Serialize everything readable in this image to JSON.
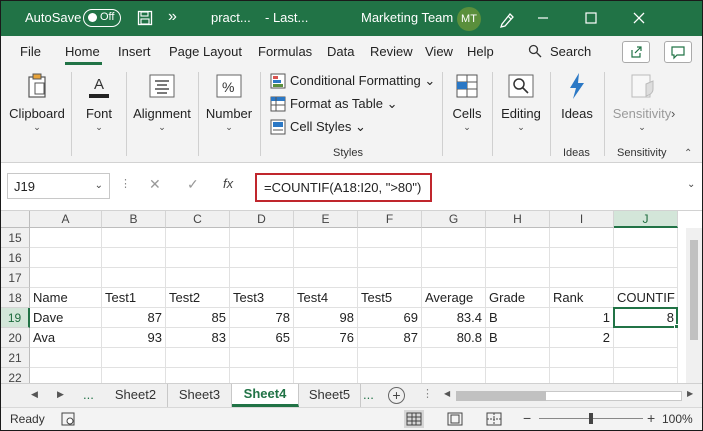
{
  "titlebar": {
    "autosave_label": "AutoSave",
    "autosave_state": "Off",
    "more": "»",
    "doc_name": "pract...",
    "doc_location": "- Last...",
    "team": "Marketing Team",
    "avatar_initials": "MT"
  },
  "tabs": [
    "File",
    "Home",
    "Insert",
    "Page Layout",
    "Formulas",
    "Data",
    "Review",
    "View",
    "Help"
  ],
  "search_label": "Search",
  "ribbon": {
    "clipboard": "Clipboard",
    "font": "Font",
    "alignment": "Alignment",
    "number": "Number",
    "styles": {
      "conditional": "Conditional Formatting",
      "table": "Format as Table",
      "cell_styles": "Cell Styles",
      "caption": "Styles"
    },
    "cells": "Cells",
    "editing": "Editing",
    "ideas": "Ideas",
    "ideas_caption": "Ideas",
    "sensitivity": "Sensitivity",
    "sensitivity_caption": "Sensitivity"
  },
  "formula_bar": {
    "name_box": "J19",
    "fx": "fx",
    "formula": "=COUNTIF(A18:I20, \">80\")"
  },
  "columns": [
    "A",
    "B",
    "C",
    "D",
    "E",
    "F",
    "G",
    "H",
    "I",
    "J"
  ],
  "selected_column": "J",
  "rows": [
    {
      "num": "15",
      "cells": [
        "",
        "",
        "",
        "",
        "",
        "",
        "",
        "",
        "",
        ""
      ]
    },
    {
      "num": "16",
      "cells": [
        "",
        "",
        "",
        "",
        "",
        "",
        "",
        "",
        "",
        ""
      ]
    },
    {
      "num": "17",
      "cells": [
        "",
        "",
        "",
        "",
        "",
        "",
        "",
        "",
        "",
        ""
      ]
    },
    {
      "num": "18",
      "cells": [
        "Name",
        "Test1",
        "Test2",
        "Test3",
        "Test4",
        "Test5",
        "Average",
        "Grade",
        "Rank",
        "COUNTIF"
      ]
    },
    {
      "num": "19",
      "cells": [
        "Dave",
        "87",
        "85",
        "78",
        "98",
        "69",
        "83.4",
        "B",
        "1",
        "8"
      ]
    },
    {
      "num": "20",
      "cells": [
        "Ava",
        "93",
        "83",
        "65",
        "76",
        "87",
        "80.8",
        "B",
        "2",
        ""
      ]
    },
    {
      "num": "21",
      "cells": [
        "",
        "",
        "",
        "",
        "",
        "",
        "",
        "",
        "",
        ""
      ]
    },
    {
      "num": "22",
      "cells": [
        "",
        "",
        "",
        "",
        "",
        "",
        "",
        "",
        "",
        ""
      ]
    }
  ],
  "selected_row": "19",
  "sheets": [
    "Sheet2",
    "Sheet3",
    "Sheet4",
    "Sheet5"
  ],
  "active_sheet": "Sheet4",
  "sheet_more": "...",
  "status": {
    "ready": "Ready",
    "zoom": "100%"
  },
  "colors": {
    "accent": "#217346",
    "highlight_border": "#c0262d"
  }
}
